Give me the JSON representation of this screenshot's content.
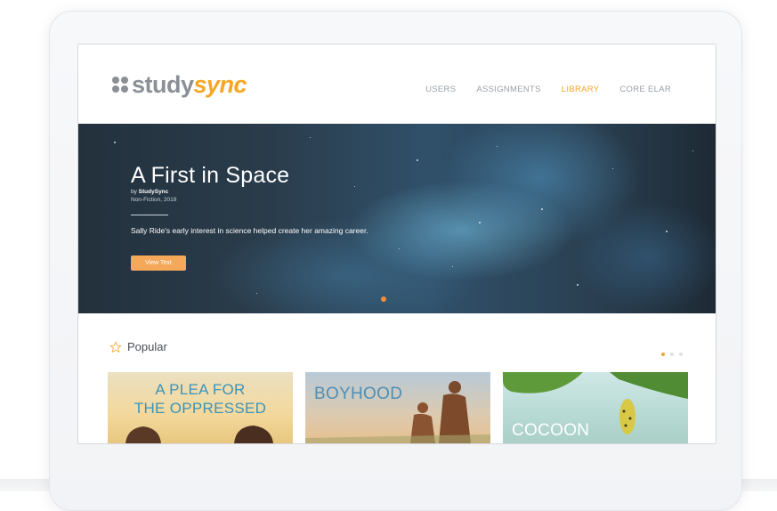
{
  "brand": {
    "logo_part1": "study",
    "logo_part2": "sync",
    "colors": {
      "accent": "#f5a623",
      "gray": "#8b8f96"
    }
  },
  "nav": {
    "items": [
      {
        "label": "USERS",
        "active": false
      },
      {
        "label": "ASSIGNMENTS",
        "active": false
      },
      {
        "label": "LIBRARY",
        "active": true
      },
      {
        "label": "CORE ELAR",
        "active": false
      }
    ]
  },
  "hero": {
    "title": "A First in Space",
    "by_prefix": "by ",
    "author": "StudySync",
    "meta": "Non-Fiction, 2018",
    "description": "Sally Ride's early interest in science helped create her amazing career.",
    "button": "View Text"
  },
  "popular": {
    "heading": "Popular",
    "icon": "star-outline-icon",
    "cards": [
      {
        "title_line1": "A PLEA FOR",
        "title_line2": "THE OPPRESSED"
      },
      {
        "title": "BOYHOOD"
      },
      {
        "title": "COCOON"
      }
    ]
  }
}
